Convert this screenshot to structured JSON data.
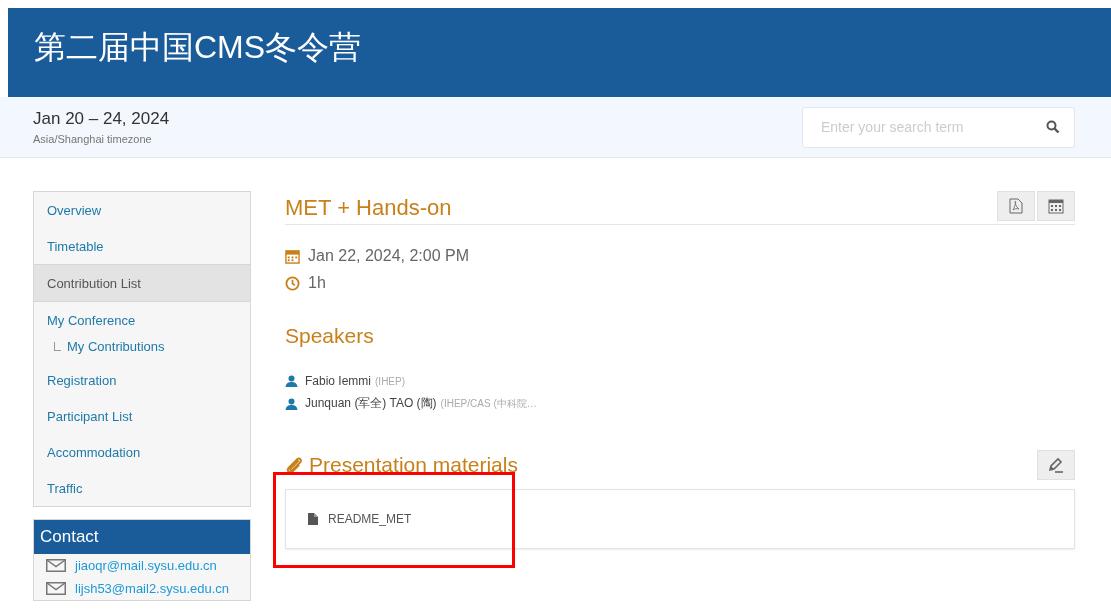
{
  "header": {
    "title": "第二届中国CMS冬令营"
  },
  "subheader": {
    "dates": "Jan 20 – 24, 2024",
    "timezone": "Asia/Shanghai timezone",
    "search": {
      "placeholder": "Enter your search term"
    }
  },
  "sidebar": {
    "items": [
      {
        "label": "Overview",
        "selected": false
      },
      {
        "label": "Timetable",
        "selected": false
      },
      {
        "label": "Contribution List",
        "selected": true
      },
      {
        "label": "My Conference",
        "selected": false,
        "children": [
          {
            "label": "My Contributions",
            "selected": false
          }
        ]
      },
      {
        "label": "Registration",
        "selected": false
      },
      {
        "label": "Participant List",
        "selected": false
      },
      {
        "label": "Accommodation",
        "selected": false
      },
      {
        "label": "Traffic",
        "selected": false
      }
    ],
    "contact": {
      "title": "Contact",
      "emails": [
        "jiaoqr@mail.sysu.edu.cn",
        "lijsh53@mail2.sysu.edu.cn"
      ]
    }
  },
  "contribution": {
    "title": "MET + Hands-on",
    "date": "Jan 22, 2024, 2:00 PM",
    "duration": "1h",
    "speakers_title": "Speakers",
    "speakers": [
      {
        "name": "Fabio Iemmi",
        "affiliation": "(IHEP)"
      },
      {
        "name": "Junquan (军全) TAO (陶)",
        "affiliation": "(IHEP/CAS (中科院…"
      }
    ],
    "materials_title": "Presentation materials",
    "materials": [
      {
        "name": "README_MET",
        "highlighted": true
      }
    ]
  }
}
